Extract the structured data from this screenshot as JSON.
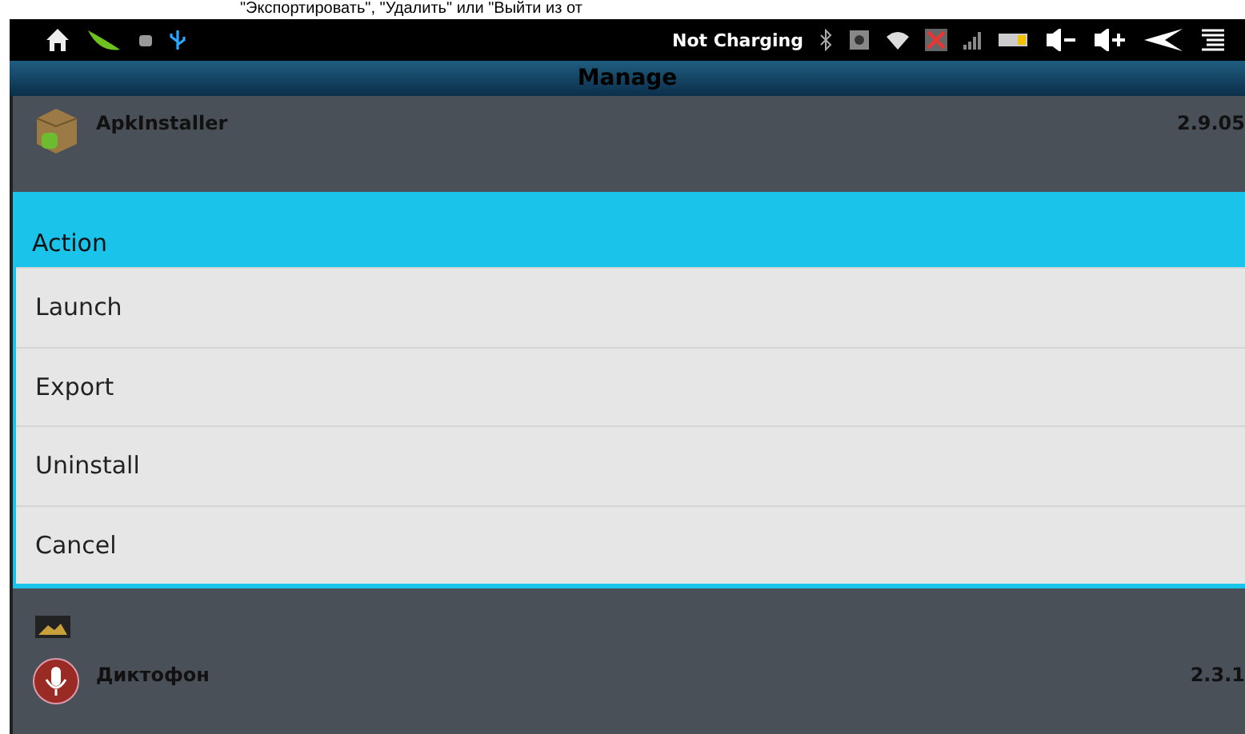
{
  "caption": "\"Экспортировать\", \"Удалить\" или \"Выйти из от",
  "status_bar": {
    "charging": "Not Charging"
  },
  "title_bar": {
    "title": "Manage"
  },
  "apps": [
    {
      "name": "ApkInstaller",
      "version": "2.9.05",
      "kind": "package"
    },
    {
      "name": "Диктофон",
      "version": "2.3.1",
      "kind": "recorder"
    }
  ],
  "dialog": {
    "title": "Action",
    "items": [
      "Launch",
      "Export",
      "Uninstall",
      "Cancel"
    ]
  }
}
